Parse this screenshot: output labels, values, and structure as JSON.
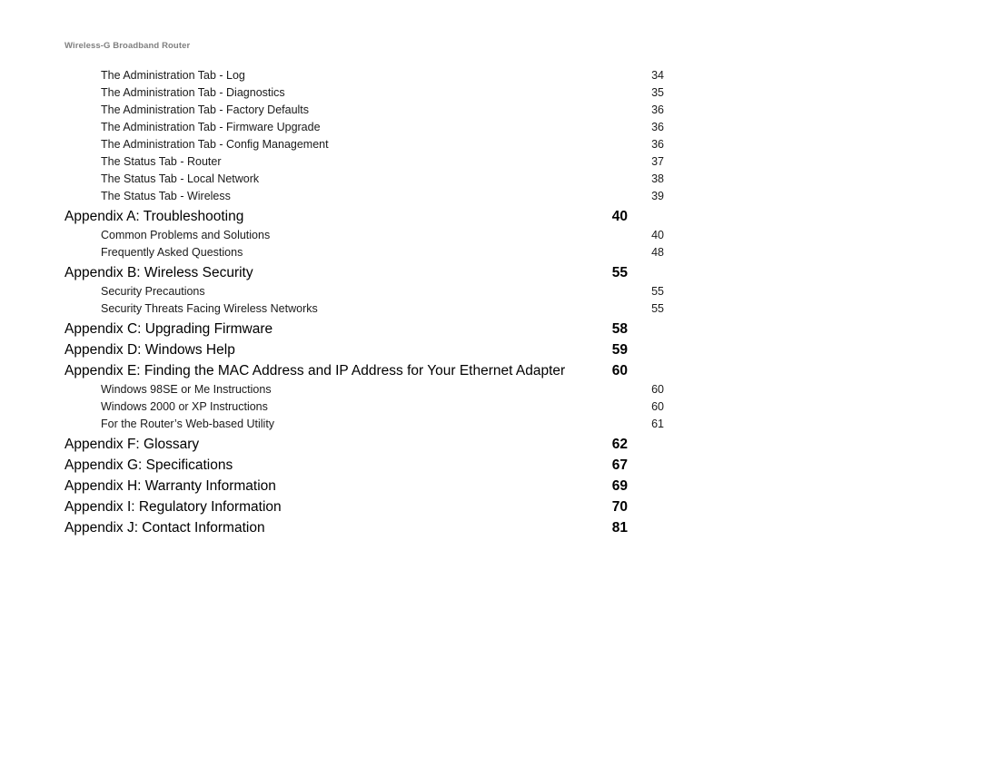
{
  "header": {
    "running_head": "Wireless-G Broadband Router",
    "color": "#808080"
  },
  "toc": {
    "entries": [
      {
        "level": 2,
        "label": "The Administration Tab - Log",
        "page": "34"
      },
      {
        "level": 2,
        "label": "The Administration Tab - Diagnostics",
        "page": "35"
      },
      {
        "level": 2,
        "label": "The Administration Tab - Factory Defaults",
        "page": "36"
      },
      {
        "level": 2,
        "label": "The Administration Tab - Firmware Upgrade",
        "page": "36"
      },
      {
        "level": 2,
        "label": "The Administration Tab - Config Management",
        "page": "36"
      },
      {
        "level": 2,
        "label": "The Status Tab - Router",
        "page": "37"
      },
      {
        "level": 2,
        "label": "The Status Tab - Local Network",
        "page": "38"
      },
      {
        "level": 2,
        "label": "The Status Tab - Wireless",
        "page": "39"
      },
      {
        "level": 1,
        "label": "Appendix A: Troubleshooting",
        "page": "40"
      },
      {
        "level": 2,
        "label": "Common Problems and Solutions",
        "page": "40"
      },
      {
        "level": 2,
        "label": "Frequently Asked Questions",
        "page": "48"
      },
      {
        "level": 1,
        "label": "Appendix B: Wireless Security",
        "page": "55"
      },
      {
        "level": 2,
        "label": "Security Precautions",
        "page": "55"
      },
      {
        "level": 2,
        "label": "Security Threats Facing Wireless Networks",
        "page": "55"
      },
      {
        "level": 1,
        "label": "Appendix C: Upgrading Firmware",
        "page": "58"
      },
      {
        "level": 1,
        "label": "Appendix D: Windows Help",
        "page": "59"
      },
      {
        "level": 1,
        "label": "Appendix E: Finding the MAC Address and IP Address for Your Ethernet Adapter",
        "page": "60"
      },
      {
        "level": 2,
        "label": "Windows 98SE or Me Instructions",
        "page": "60"
      },
      {
        "level": 2,
        "label": "Windows 2000 or XP Instructions",
        "page": "60"
      },
      {
        "level": 2,
        "label": "For the Router’s Web-based Utility",
        "page": "61"
      },
      {
        "level": 1,
        "label": "Appendix F: Glossary",
        "page": "62"
      },
      {
        "level": 1,
        "label": "Appendix G: Specifications",
        "page": "67"
      },
      {
        "level": 1,
        "label": "Appendix H: Warranty Information",
        "page": "69"
      },
      {
        "level": 1,
        "label": "Appendix I: Regulatory Information",
        "page": "70"
      },
      {
        "level": 1,
        "label": "Appendix J: Contact Information",
        "page": "81"
      }
    ]
  }
}
